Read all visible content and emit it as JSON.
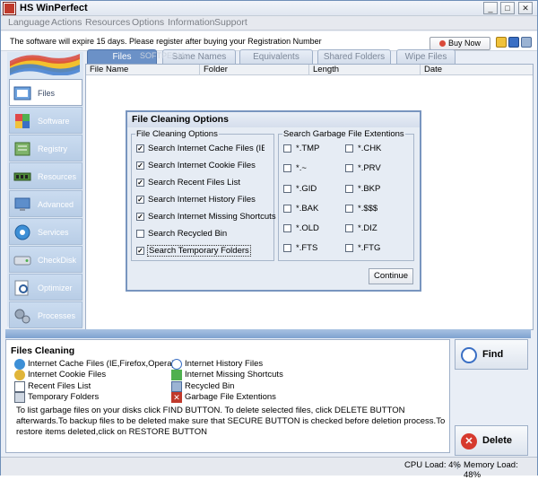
{
  "window": {
    "title": "HS WinPerfect",
    "minimize": "_",
    "maximize": "□",
    "close": "✕"
  },
  "menu": [
    "Language",
    "Actions",
    "Resources",
    "Options",
    "Information",
    "Support"
  ],
  "notice": {
    "text": "The software will expire 15 days. Please register after buying your Registration Number",
    "buy_label": "Buy Now"
  },
  "sidebar": [
    {
      "label": "Files",
      "icon": "folder-icon",
      "active": true
    },
    {
      "label": "Software",
      "icon": "software-icon"
    },
    {
      "label": "Registry",
      "icon": "registry-icon"
    },
    {
      "label": "Resources",
      "icon": "memory-icon"
    },
    {
      "label": "Advanced",
      "icon": "monitor-icon"
    },
    {
      "label": "Services",
      "icon": "gear-icon"
    },
    {
      "label": "CheckDisk",
      "icon": "disk-icon"
    },
    {
      "label": "Optimizer",
      "icon": "magnifier-icon"
    },
    {
      "label": "Processes",
      "icon": "gears-icon"
    }
  ],
  "tabs": [
    "Files",
    "Same Names",
    "Equivalents",
    "Shared Folders",
    "Wipe Files"
  ],
  "columns": [
    "File Name",
    "Folder",
    "Length",
    "Date"
  ],
  "watermark": "SOFTPEDIA",
  "dialog": {
    "title": "File Cleaning Options",
    "left_group": "File Cleaning Options",
    "right_group": "Search Garbage File Extentions",
    "options": [
      {
        "label": "Search Internet Cache Files (IE,Firefox,Opera)",
        "checked": true
      },
      {
        "label": "Search Internet Cookie Files",
        "checked": true
      },
      {
        "label": "Search Recent Files List",
        "checked": true
      },
      {
        "label": "Search Internet History Files",
        "checked": true
      },
      {
        "label": "Search Internet Missing Shortcuts",
        "checked": true
      },
      {
        "label": "Search Recycled Bin",
        "checked": false
      },
      {
        "label": "Search Temporary Folders",
        "checked": true
      }
    ],
    "ext_left": [
      "*.TMP",
      "*.~",
      "*.GID",
      "*.BAK",
      "*.OLD",
      "*.FTS"
    ],
    "ext_right": [
      "*.CHK",
      "*.PRV",
      "*.BKP",
      "*.$$$",
      "*.DIZ",
      "*.FTG"
    ],
    "continue_label": "Continue"
  },
  "info": {
    "title": "Files Cleaning",
    "items_left": [
      "Internet Cache Files (IE,Firefox,Opera)",
      "Internet Cookie Files",
      "Recent Files List",
      "Temporary Folders"
    ],
    "items_right": [
      "Internet History Files",
      "Internet Missing Shortcuts",
      "Recycled Bin",
      "Garbage File Extentions"
    ],
    "description": "To list garbage files on your disks click FIND BUTTON. To delete selected files, click DELETE BUTTON afterwards.To backup files to be deleted make sure that SECURE BUTTON is checked before deletion process.To restore items deleted,click on RESTORE BUTTON"
  },
  "buttons": {
    "find": "Find",
    "delete": "Delete"
  },
  "status": {
    "cpu": "CPU Load: 4%",
    "memory": "Memory Load: 48%"
  },
  "colors": {
    "accent": "#6b91c7",
    "sidebar": "#dbe6f3",
    "splitter": "#7fa2d0"
  }
}
